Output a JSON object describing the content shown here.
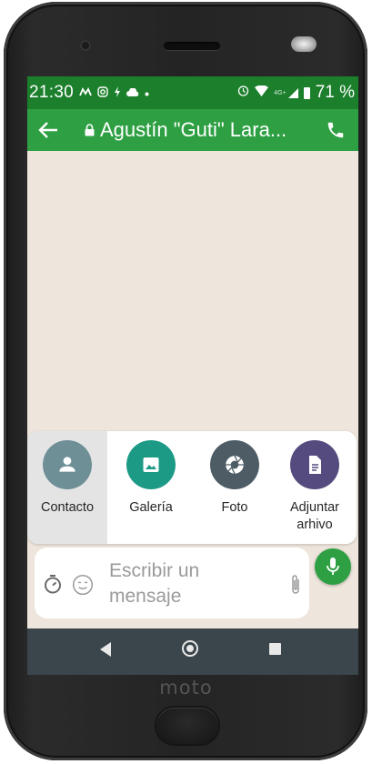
{
  "device": {
    "brand": "moto"
  },
  "status_bar": {
    "time": "21:30",
    "left_icons": [
      "motorola-icon",
      "instagram-icon",
      "notification-icon",
      "cloud-icon",
      "dot-icon"
    ],
    "right_icons": [
      "alarm-icon",
      "wifi-icon",
      "lte-signal-icon",
      "battery-icon"
    ],
    "network_label": "4G+",
    "battery": "71 %"
  },
  "app_bar": {
    "title": "Agustín \"Guti\" Lara...",
    "color": "#2ea043"
  },
  "attach_options": [
    {
      "label": "Contacto",
      "icon": "person-icon",
      "color": "#6f8f96",
      "selected": true
    },
    {
      "label": "Galería",
      "icon": "image-icon",
      "color": "#1d9a86",
      "selected": false
    },
    {
      "label": "Foto",
      "icon": "camera-aperture-icon",
      "color": "#4e5c66",
      "selected": false
    },
    {
      "label": "Adjuntar arhivo",
      "icon": "document-icon",
      "color": "#554b7e",
      "selected": false
    }
  ],
  "composer": {
    "placeholder": "Escribir un mensaje"
  },
  "colors": {
    "status_bar": "#1b7f2c",
    "chat_background": "#eee6dc",
    "nav_bar": "#3b454c"
  }
}
